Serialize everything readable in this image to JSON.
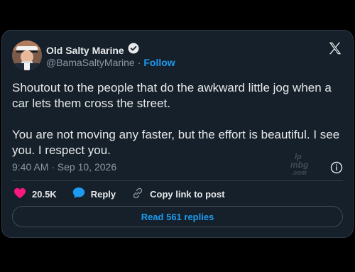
{
  "user": {
    "display_name": "Old Salty Marine",
    "handle": "@BamaSaltyMarine",
    "separator": "·",
    "follow_label": "Follow",
    "verified": true
  },
  "tweet": {
    "text": "Shoutout to the people that do the awkward little jog when a car lets them cross the street.\n\nYou are not moving any faster, but the effort is beautiful. I see you. I respect you.",
    "timestamp": "9:40 AM · Sep 10, 2026"
  },
  "actions": {
    "like_count": "20.5K",
    "reply_label": "Reply",
    "copy_link_label": "Copy link to post"
  },
  "footer": {
    "read_replies_label": "Read 561 replies"
  },
  "watermark": {
    "text": "lp mbg .com"
  },
  "colors": {
    "background": "#000000",
    "card": "#15202b",
    "accent": "#1d9bf0",
    "like": "#f91880",
    "text": "#e7e9ea",
    "muted": "#8b98a5"
  },
  "icons": [
    "verified-badge-icon",
    "x-logo-icon",
    "info-icon",
    "heart-icon",
    "reply-bubble-icon",
    "link-icon"
  ]
}
